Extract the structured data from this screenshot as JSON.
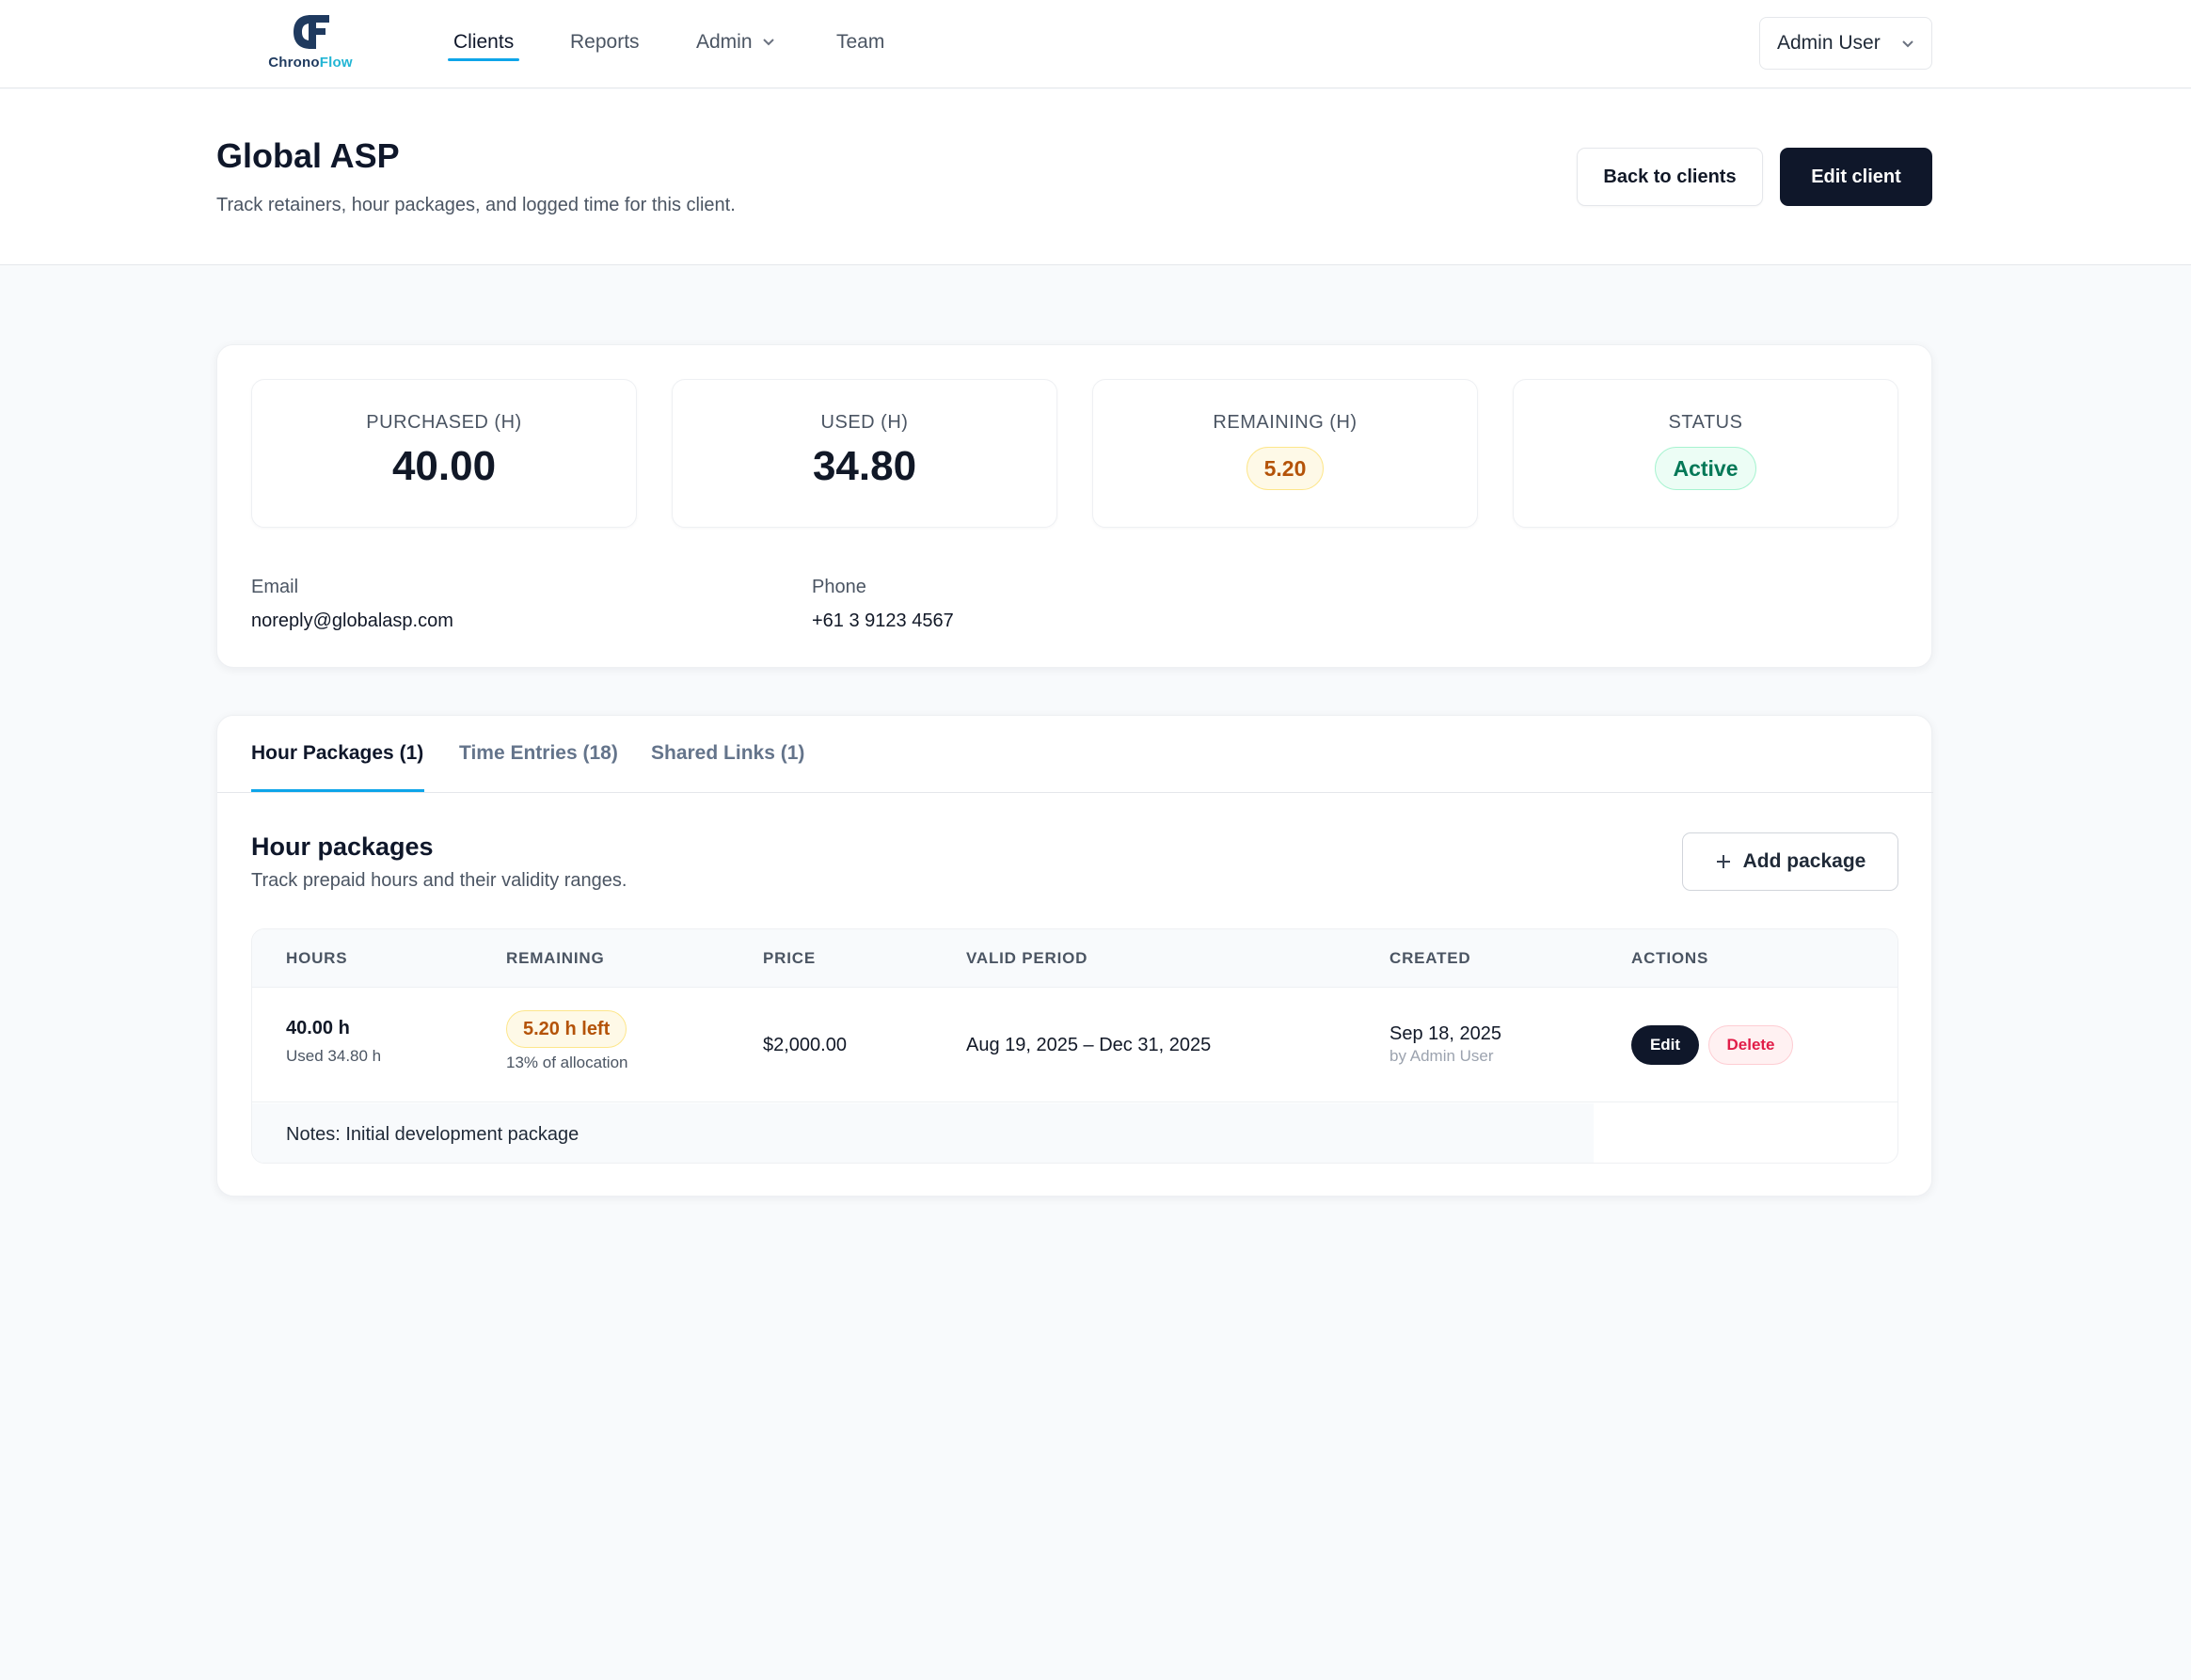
{
  "brand": {
    "name_part1": "Chrono",
    "name_part2": "Flow"
  },
  "nav": {
    "items": [
      {
        "label": "Clients"
      },
      {
        "label": "Reports"
      },
      {
        "label": "Admin"
      },
      {
        "label": "Team"
      }
    ],
    "user": "Admin User"
  },
  "header": {
    "title": "Global ASP",
    "subtitle": "Track retainers, hour packages, and logged time for this client.",
    "back_label": "Back to clients",
    "edit_label": "Edit client"
  },
  "summary": {
    "purchased": {
      "label": "PURCHASED (H)",
      "value": "40.00"
    },
    "used": {
      "label": "USED (H)",
      "value": "34.80"
    },
    "remaining": {
      "label": "REMAINING (H)",
      "value": "5.20"
    },
    "status": {
      "label": "STATUS",
      "value": "Active"
    },
    "email": {
      "label": "Email",
      "value": "noreply@globalasp.com"
    },
    "phone": {
      "label": "Phone",
      "value": "+61 3 9123 4567"
    }
  },
  "tabs": [
    {
      "label": "Hour Packages (1)"
    },
    {
      "label": "Time Entries (18)"
    },
    {
      "label": "Shared Links (1)"
    }
  ],
  "packages": {
    "title": "Hour packages",
    "subtitle": "Track prepaid hours and their validity ranges.",
    "add_label": "Add package",
    "columns": [
      "HOURS",
      "REMAINING",
      "PRICE",
      "VALID PERIOD",
      "CREATED",
      "ACTIONS"
    ],
    "rows": [
      {
        "hours": "40.00 h",
        "used": "Used 34.80 h",
        "remaining": "5.20 h left",
        "allocation": "13% of allocation",
        "price": "$2,000.00",
        "period": "Aug 19, 2025 – Dec 31, 2025",
        "created": "Sep 18, 2025",
        "created_by": "by Admin User",
        "edit_label": "Edit",
        "delete_label": "Delete",
        "notes": "Notes: Initial development package"
      }
    ]
  },
  "colors": {
    "accent": "#0ea5e9",
    "primary_dark": "#0f172a",
    "amber": "#b45309",
    "green": "#047857",
    "danger": "#e11d48"
  }
}
